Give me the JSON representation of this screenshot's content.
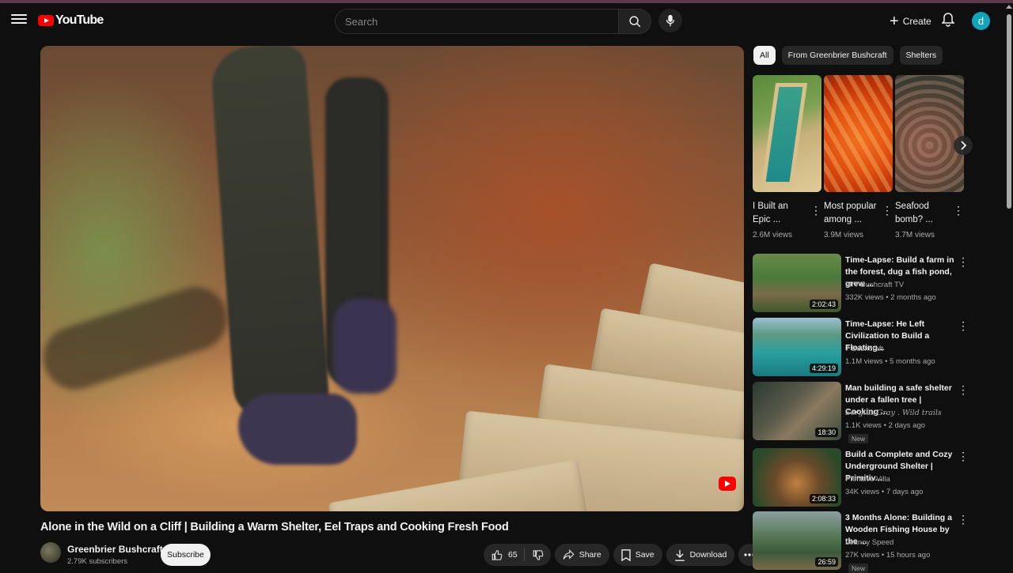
{
  "header": {
    "logo_text": "YouTube",
    "search_placeholder": "Search",
    "create_label": "Create",
    "avatar_letter": "d"
  },
  "video": {
    "title": "Alone in the Wild on a Cliff | Building a Warm Shelter, Eel Traps and Cooking Fresh Food",
    "channel": "Greenbrier Bushcraft",
    "subscribers": "2.79K subscribers",
    "subscribe_label": "Subscribe",
    "likes": "65",
    "share_label": "Share",
    "save_label": "Save",
    "download_label": "Download"
  },
  "sidebar": {
    "chips": [
      {
        "label": "All",
        "active": true
      },
      {
        "label": "From Greenbrier Bushcraft",
        "active": false
      },
      {
        "label": "Shelters",
        "active": false
      }
    ],
    "shorts": [
      {
        "title": "I Built an Epic ...",
        "views": "2.6M views"
      },
      {
        "title": "Most popular among ...",
        "views": "3.9M views"
      },
      {
        "title": "Seafood bomb? ...",
        "views": "3.7M views"
      }
    ],
    "videos": [
      {
        "title": "Time-Lapse: Build a farm in the forest, dug a fish pond, grew ...",
        "channel": "MrT Bushcraft TV",
        "meta": "332K views • 2 months ago",
        "duration": "2:02:43",
        "badge": ""
      },
      {
        "title": "Time-Lapse: He Left Civilization to Build a Floating...",
        "channel": "7 Bushcraft",
        "meta": "1.1M views • 5 months ago",
        "duration": "4:29:19",
        "badge": ""
      },
      {
        "title": "Man building a safe shelter under a fallen tree | Cooking ...",
        "channel": "Sergius Gray . Wild trails",
        "meta": "1.1K views • 2 days ago",
        "duration": "18:30",
        "badge": "New"
      },
      {
        "title": "Build a Complete and Cozy Underground Shelter | Primitiv...",
        "channel": "Primitive Villa",
        "meta": "34K views • 7 days ago",
        "duration": "2:08:33",
        "badge": ""
      },
      {
        "title": "3 Months Alone: Building a Wooden Fishing House by the ...",
        "channel": "Leanoy Speed",
        "meta": "27K views • 15 hours ago",
        "duration": "26:59",
        "badge": "New"
      }
    ]
  },
  "colors": {
    "background": "#0f0f0f",
    "brand_red": "#ff0000",
    "avatar": "#12a4b8"
  }
}
